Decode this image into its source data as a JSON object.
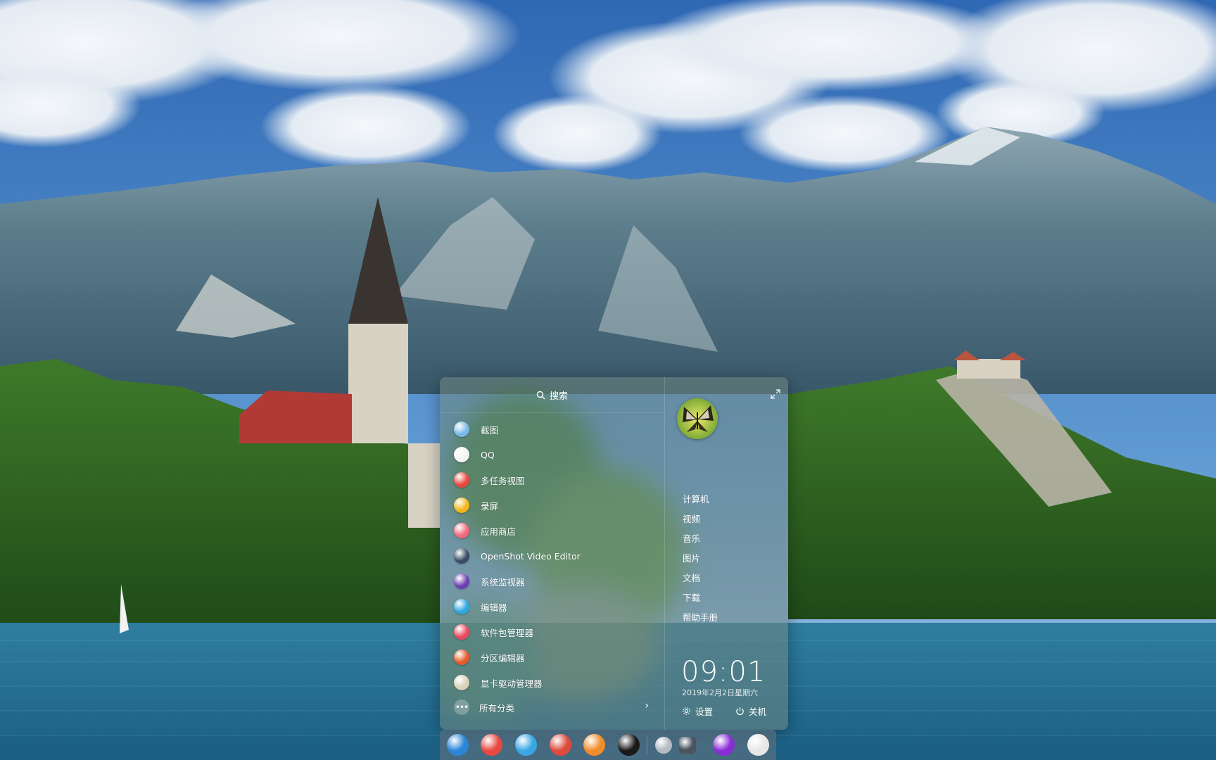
{
  "launcher": {
    "search_placeholder": "搜索",
    "apps": [
      {
        "label": "截图",
        "icon": "screenshot-icon",
        "color": "#7ab8e8"
      },
      {
        "label": "QQ",
        "icon": "qq-penguin-icon",
        "color": "#f4f4f4"
      },
      {
        "label": "多任务视图",
        "icon": "multitask-view-icon",
        "color": "#e8493f"
      },
      {
        "label": "录屏",
        "icon": "screen-recorder-icon",
        "color": "#f3b51c"
      },
      {
        "label": "应用商店",
        "icon": "app-store-icon",
        "color": "#f06a7a"
      },
      {
        "label": "OpenShot Video Editor",
        "icon": "openshot-icon",
        "color": "#3a4d66"
      },
      {
        "label": "系统监视器",
        "icon": "system-monitor-icon",
        "color": "#6e3fb0"
      },
      {
        "label": "编辑器",
        "icon": "text-editor-icon",
        "color": "#2ea8e0"
      },
      {
        "label": "软件包管理器",
        "icon": "package-manager-icon",
        "color": "#e84a5f"
      },
      {
        "label": "分区编辑器",
        "icon": "partition-editor-icon",
        "color": "#e35c2b"
      },
      {
        "label": "显卡驱动管理器",
        "icon": "gpu-driver-icon",
        "color": "#d8d0b8"
      }
    ],
    "all_categories": "所有分类",
    "places": [
      "计算机",
      "视频",
      "音乐",
      "图片",
      "文档",
      "下载",
      "帮助手册"
    ],
    "time": "09:01",
    "date": "2019年2月2日星期六",
    "settings_label": "设置",
    "power_label": "关机"
  },
  "dock": {
    "items": [
      {
        "name": "launcher-icon",
        "color": "#2a86d6"
      },
      {
        "name": "multitask-view-icon",
        "color": "#e8493f"
      },
      {
        "name": "file-manager-icon",
        "color": "#3aa7e4"
      },
      {
        "name": "chrome-icon",
        "color": "#dd4b3e"
      },
      {
        "name": "settings-app-icon",
        "color": "#f08c2a"
      },
      {
        "name": "qq-penguin-icon",
        "color": "#1a1a1a"
      },
      {
        "name": "tray-expand-icon",
        "color": "#b5bcc2"
      },
      {
        "name": "keyboard-icon",
        "color": "#4a5560"
      },
      {
        "name": "power-icon",
        "color": "#8a2cd6"
      },
      {
        "name": "trash-icon",
        "color": "#e7e7e7"
      }
    ]
  }
}
